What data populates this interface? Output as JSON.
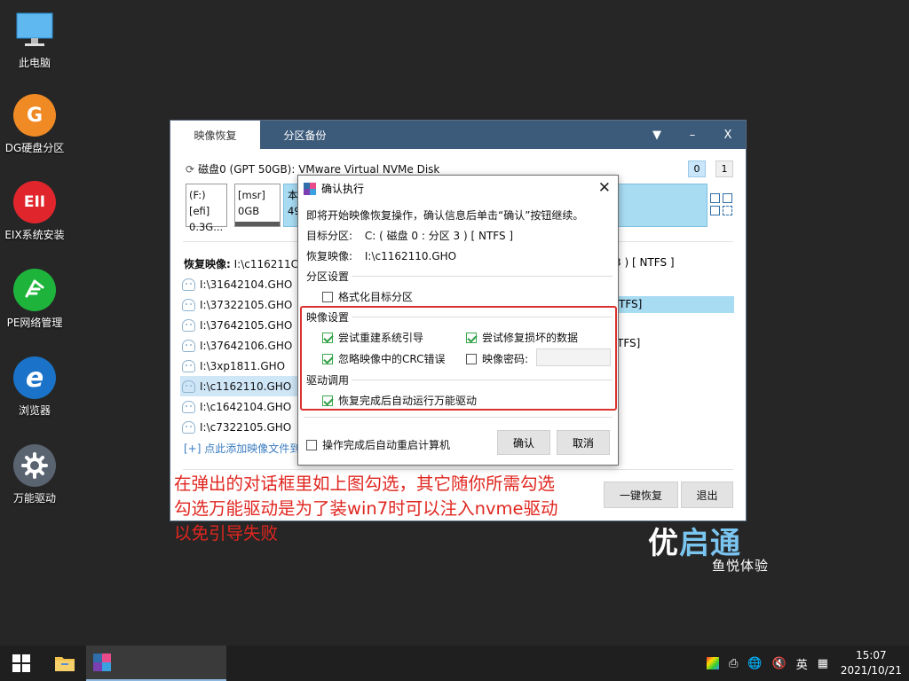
{
  "desktop": {
    "icons": [
      {
        "label": "此电脑",
        "icon": "computer-icon"
      },
      {
        "label": "DG硬盘分区",
        "icon": "diskgenius-icon",
        "glyph": "G"
      },
      {
        "label": "EIX系统安装",
        "icon": "eix-icon",
        "glyph": "EII"
      },
      {
        "label": "PE网络管理",
        "icon": "network-manager-icon"
      },
      {
        "label": "浏览器",
        "icon": "browser-icon",
        "glyph": "e"
      },
      {
        "label": "万能驱动",
        "icon": "gear-icon"
      }
    ]
  },
  "window": {
    "tabs": [
      "映像恢复",
      "分区备份"
    ],
    "controls": {
      "dropdown": "▼",
      "minimize": "–",
      "close": "X"
    },
    "disk": {
      "label": "磁盘0 (GPT 50GB): VMware Virtual NVMe Disk",
      "toggle_0": "0",
      "toggle_1": "1"
    },
    "partitions": [
      {
        "name": "(F:)[efi]",
        "size": "0.3G..."
      },
      {
        "name": "[msr]",
        "size": "0GB"
      },
      {
        "name": "本",
        "size": "49"
      }
    ],
    "restore_label": "恢复映像:",
    "restore_value": "I:\\c116211C",
    "restore_right": "3 ) [ NTFS ]",
    "files": [
      "I:\\31642104.GHO",
      "I:\\37322105.GHO",
      "I:\\37642105.GHO",
      "I:\\37642106.GHO",
      "I:\\3xp1811.GHO",
      "I:\\c1162110.GHO",
      "I:\\c1642104.GHO",
      "I:\\c7322105.GHO"
    ],
    "selected_file_index": 5,
    "list_right_1": "TFS]",
    "list_right_2": "TFS]",
    "add_link": "[+] 点此添加映像文件到",
    "btn_restore": "一键恢复",
    "btn_exit": "退出"
  },
  "dialog": {
    "title": "确认执行",
    "close": "✕",
    "intro": "即将开始映像恢复操作，确认信息后单击“确认”按钮继续。",
    "target_label": "目标分区:",
    "target_value": "C: ( 磁盘 0 : 分区 3 ) [ NTFS ]",
    "image_label": "恢复映像:",
    "image_value": "I:\\c1162110.GHO",
    "sect_partition": "分区设置",
    "cb_format": "格式化目标分区",
    "sect_image": "映像设置",
    "cb_rebuild_boot": "尝试重建系统引导",
    "cb_repair": "尝试修复损坏的数据",
    "cb_ignore_crc": "忽略映像中的CRC错误",
    "cb_password": "映像密码:",
    "sect_driver": "驱动调用",
    "cb_auto_driver": "恢复完成后自动运行万能驱动",
    "cb_auto_reboot": "操作完成后自动重启计算机",
    "btn_ok": "确认",
    "btn_cancel": "取消",
    "checks": {
      "format": false,
      "rebuild_boot": true,
      "repair": true,
      "ignore_crc": true,
      "password": false,
      "auto_driver": true,
      "auto_reboot": false
    }
  },
  "annotation": {
    "line1": "在弹出的对话框里如上图勾选，其它随你所需勾选",
    "line2": "勾选万能驱动是为了装win7时可以注入nvme驱动",
    "line3": "以免引导失败"
  },
  "brand": {
    "name_a": "优",
    "name_b": "启通",
    "sub": "鱼悦体验"
  },
  "taskbar": {
    "ime": "英",
    "time": "15:07",
    "date": "2021/10/21"
  },
  "colors": {
    "accent": "#3c5a7a",
    "highlight": "#a8dcf3",
    "annotation": "#e0261f",
    "redbox": "#d9322f"
  }
}
